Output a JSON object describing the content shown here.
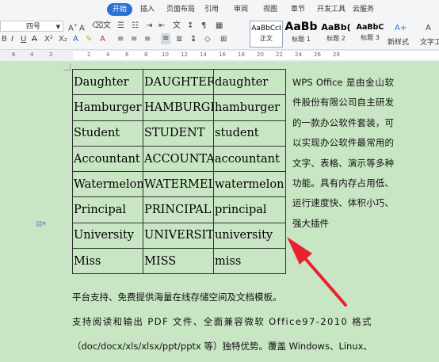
{
  "ribbon": {
    "tabs": [
      "开始",
      "插入",
      "页面布局",
      "引用",
      "审阅",
      "视图",
      "章节",
      "开发工具",
      "云服务"
    ],
    "active_tab": "开始",
    "font_size": "四号",
    "styles": [
      {
        "preview": "AaBbCcI",
        "name": "正文"
      },
      {
        "preview": "AaBb",
        "name": "标题 1"
      },
      {
        "preview": "AaBb(",
        "name": "标题 2"
      },
      {
        "preview": "AaBbC",
        "name": "标题 3"
      }
    ],
    "new_style": "新样式",
    "text_tools": "文字工"
  },
  "ruler": [
    "6",
    "4",
    "2",
    "2",
    "4",
    "6",
    "8",
    "10",
    "12",
    "14",
    "16",
    "18",
    "20",
    "22",
    "24",
    "26",
    "28"
  ],
  "table": [
    [
      "Daughter",
      "DAUGHTER",
      "daughter"
    ],
    [
      "Hamburger",
      "HAMBURGER",
      "hamburger"
    ],
    [
      "Student",
      "STUDENT",
      "student"
    ],
    [
      "Accountant",
      "ACCOUNTANT",
      "accountant"
    ],
    [
      "Watermelon",
      "WATERMELON",
      "watermelon"
    ],
    [
      "Principal",
      "PRINCIPAL",
      "principal"
    ],
    [
      "University",
      "UNIVERSITY",
      "university"
    ],
    [
      "Miss",
      "MISS",
      "miss"
    ]
  ],
  "side_text": "WPS Office 是由金山软件股份有限公司自主研发的一款办公软件套装，可以实现办公软件最常用的文字、表格、演示等多种功能。具有内存占用低、运行速度快、体积小巧、强大插件",
  "paragraphs": [
    "平台支持、免费提供海量在线存储空间及文档模板。",
    "支持阅读和输出 PDF 文件、全面兼容微软 Office97-2010 格式",
    "（doc/docx/xls/xlsx/ppt/pptx 等）独特优势。覆盖 Windows、Linux、"
  ],
  "colors": {
    "accent": "#2b6fd6",
    "page": "#c9e6c4",
    "arrow": "#e8222e"
  }
}
